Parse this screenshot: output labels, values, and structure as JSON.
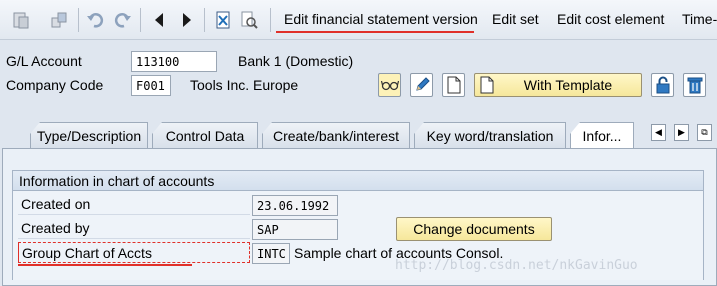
{
  "toolbar": {
    "icons": [
      "display-change-icon",
      "other-object-icon",
      "undo-icon",
      "redo-icon",
      "previous-icon",
      "next-icon",
      "delete-icon",
      "find-icon"
    ],
    "menu": {
      "edit_fs_version": "Edit financial statement version",
      "edit_set": "Edit set",
      "edit_cost_element": "Edit cost element",
      "time": "Time-"
    }
  },
  "header": {
    "gl_account_label": "G/L Account",
    "gl_account_value": "113100",
    "gl_account_desc": "Bank 1 (Domestic)",
    "company_code_label": "Company Code",
    "company_code_value": "F001",
    "company_code_desc": "Tools Inc. Europe",
    "with_template_label": "With Template"
  },
  "tabs": [
    {
      "label": "Type/Description"
    },
    {
      "label": "Control Data"
    },
    {
      "label": "Create/bank/interest"
    },
    {
      "label": "Key word/translation"
    },
    {
      "label": "Infor..."
    }
  ],
  "info": {
    "group_title": "Information in chart of accounts",
    "created_on_label": "Created on",
    "created_on_value": "23.06.1992",
    "created_by_label": "Created by",
    "created_by_value": "SAP",
    "change_documents_label": "Change documents",
    "group_coa_label": "Group Chart of Accts",
    "group_coa_value": "INTC",
    "group_coa_desc": "Sample chart of accounts Consol."
  },
  "watermark": "http://blog.csdn.net/nkGavinGuo",
  "colors": {
    "accent_underline": "#e0302a",
    "button_yellow": "#f6e79b",
    "background": "#dfe6ef"
  }
}
